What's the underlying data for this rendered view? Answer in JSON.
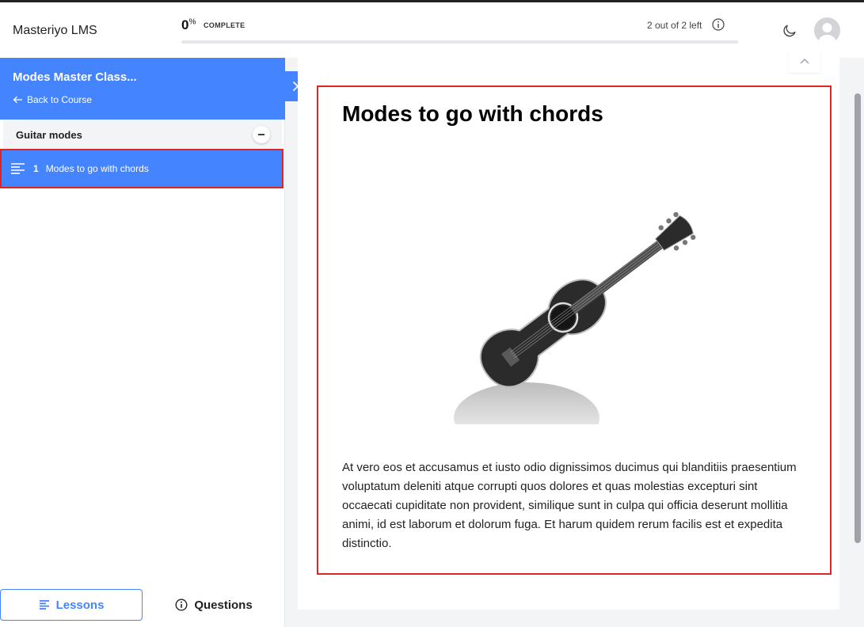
{
  "header": {
    "logo": "Masteriyo LMS",
    "progress_percent": "0",
    "percent_sign": "%",
    "progress_label": "COMPLETE",
    "progress_fraction": 0,
    "remaining": "2 out of 2 left"
  },
  "sidebar": {
    "course_title": "Modes Master Class...",
    "back_label": "Back to Course",
    "section_title": "Guitar modes",
    "lessons": [
      {
        "number": "1",
        "label": "Modes to go with chords"
      }
    ],
    "tabs": {
      "lessons": "Lessons",
      "questions": "Questions"
    }
  },
  "lesson": {
    "title": "Modes to go with chords",
    "body": "At vero eos et accusamus et iusto odio dignissimos ducimus qui blanditiis praesentium voluptatum deleniti atque corrupti quos dolores et quas molestias excepturi sint occaecati cupiditate non provident, similique sunt in culpa qui officia deserunt mollitia animi, id est laborum et dolorum fuga. Et harum quidem rerum facilis est et expedita distinctio."
  },
  "colors": {
    "accent": "#4584ff",
    "highlight_border": "#dc2626"
  },
  "icons": [
    "info-icon",
    "moon-icon",
    "avatar-icon",
    "back-arrow-icon",
    "close-icon",
    "collapse-minus-icon",
    "lesson-text-icon",
    "lessons-tab-icon",
    "questions-info-icon",
    "chevron-up-icon",
    "guitar-image"
  ]
}
